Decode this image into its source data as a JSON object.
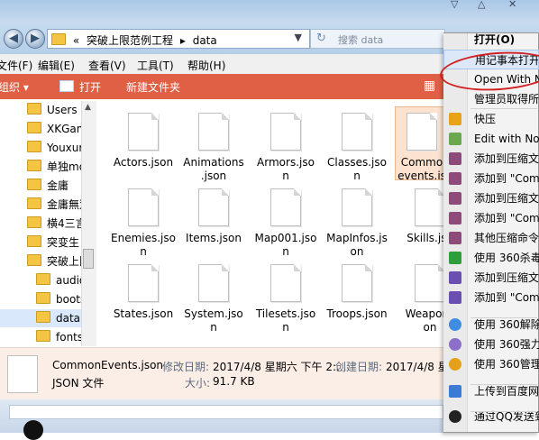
{
  "window": {
    "controls": [
      "▽",
      "△",
      "✕"
    ]
  },
  "address": {
    "prefix": "«",
    "path": [
      "突破上限范例工程",
      "data"
    ],
    "separator": "▸",
    "search_placeholder": "搜索 data"
  },
  "menubar": [
    "文件(F)",
    "编辑(E)",
    "查看(V)",
    "工具(T)",
    "帮助(H)"
  ],
  "cmdbar": {
    "organize": "组织 ▾",
    "open": "打开",
    "new_folder": "新建文件夹"
  },
  "nav": {
    "items": [
      {
        "label": "Users",
        "indent": 0,
        "selected": false
      },
      {
        "label": "XKGam",
        "indent": 0,
        "selected": false
      },
      {
        "label": "Youxur",
        "indent": 0,
        "selected": false
      },
      {
        "label": "单独mo",
        "indent": 0,
        "selected": false
      },
      {
        "label": "金庸",
        "indent": 0,
        "selected": false
      },
      {
        "label": "金庸無双",
        "indent": 0,
        "selected": false
      },
      {
        "label": "横4三言",
        "indent": 0,
        "selected": false
      },
      {
        "label": "突变生",
        "indent": 0,
        "selected": false
      },
      {
        "label": "突破上限",
        "indent": 0,
        "selected": false
      },
      {
        "label": "audio",
        "indent": 1,
        "selected": false
      },
      {
        "label": "boots",
        "indent": 1,
        "selected": false
      },
      {
        "label": "data",
        "indent": 1,
        "selected": true
      },
      {
        "label": "fonts",
        "indent": 1,
        "selected": false
      }
    ]
  },
  "files": [
    {
      "name": "Actors.json",
      "selected": false
    },
    {
      "name": "Animations\n.json",
      "selected": false
    },
    {
      "name": "Armors.jso\nn",
      "selected": false
    },
    {
      "name": "Classes.jso\nn",
      "selected": false
    },
    {
      "name": "Commo\nevents.js",
      "selected": true
    },
    {
      "name": "Enemies.jso\nn",
      "selected": false
    },
    {
      "name": "Items.json",
      "selected": false
    },
    {
      "name": "Map001.jso\nn",
      "selected": false
    },
    {
      "name": "MapInfos.js\non",
      "selected": false
    },
    {
      "name": "Skills.jso",
      "selected": false
    },
    {
      "name": "States.json",
      "selected": false
    },
    {
      "name": "System.jso\nn",
      "selected": false
    },
    {
      "name": "Tilesets.jso\nn",
      "selected": false
    },
    {
      "name": "Troops.json",
      "selected": false
    },
    {
      "name": "Weapons\non",
      "selected": false
    }
  ],
  "details": {
    "filename": "CommonEvents.json",
    "type": "JSON 文件",
    "modified_label": "修改日期:",
    "modified_value": "2017/4/8 星期六 下午 2:...",
    "created_label": "创建日期:",
    "created_value": "2017/4/8 星期",
    "size_label": "大小:",
    "size_value": "91.7 KB"
  },
  "context_menu": {
    "items": [
      {
        "label": "打开(O)",
        "bold": true,
        "icon": "none",
        "color": ""
      },
      {
        "label": "用记事本打开",
        "bold": false,
        "icon": "none",
        "color": "",
        "highlight": true
      },
      {
        "label": "Open With No",
        "bold": false,
        "icon": "none",
        "color": ""
      },
      {
        "label": "管理员取得所",
        "bold": false,
        "icon": "none",
        "color": ""
      },
      {
        "label": "快压",
        "bold": false,
        "icon": "kuaiya-icon",
        "color": "#e8a317"
      },
      {
        "label": "Edit with Note",
        "bold": false,
        "icon": "notepad-icon",
        "color": "#6aa84f"
      },
      {
        "label": "添加到压缩文",
        "bold": false,
        "icon": "winrar-icon",
        "color": "#8e4b7a"
      },
      {
        "label": "添加到 \"Com",
        "bold": false,
        "icon": "winrar-icon",
        "color": "#8e4b7a"
      },
      {
        "label": "添加到压缩文",
        "bold": false,
        "icon": "winrar-icon",
        "color": "#8e4b7a"
      },
      {
        "label": "添加到 \"Com",
        "bold": false,
        "icon": "winrar-icon",
        "color": "#8e4b7a"
      },
      {
        "label": "其他压缩命令",
        "bold": false,
        "icon": "winrar-icon",
        "color": "#8e4b7a"
      },
      {
        "label": "使用 360杀毒",
        "bold": false,
        "icon": "shield-icon",
        "color": "#2e9e3a"
      },
      {
        "label": "添加到压缩文",
        "bold": false,
        "icon": "archive-icon",
        "color": "#6b4fb0"
      },
      {
        "label": "添加到 \"Com",
        "bold": false,
        "icon": "archive-icon",
        "color": "#6b4fb0"
      },
      {
        "label": "使用 360解除",
        "bold": false,
        "icon": "360-icon",
        "color": "#3f8de0"
      },
      {
        "label": "使用 360强力",
        "bold": false,
        "icon": "360-icon",
        "color": "#8c6fc9"
      },
      {
        "label": "使用 360管理",
        "bold": false,
        "icon": "360-icon",
        "color": "#e4a21a"
      },
      {
        "label": "上传到百度网",
        "bold": false,
        "icon": "baidu-cloud-icon",
        "color": "#3a7bd5"
      },
      {
        "label": "通过QQ发送到",
        "bold": false,
        "icon": "qq-icon",
        "color": "#222222"
      }
    ]
  },
  "accent": {
    "cmdbar": "#e06046",
    "selection": "#fbe3cf",
    "highlight_circle": "#d02020"
  }
}
